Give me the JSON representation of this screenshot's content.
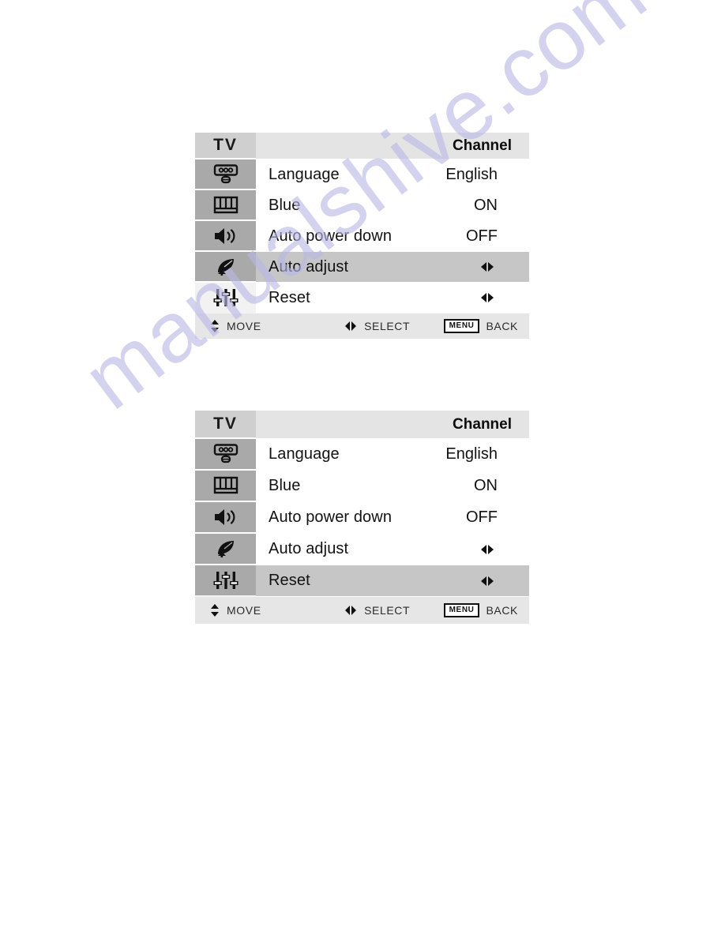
{
  "page": {
    "watermark": "manualshive.com",
    "watermark_color": "#b9b7e6",
    "background": "#ffffff"
  },
  "colors": {
    "icon_column": "#a9a9a9",
    "header_cell": "#cfcfcf",
    "header_bar": "#e4e4e4",
    "row_selected": "#c6c6c6",
    "row_normal": "#ffffff",
    "footer": "#e6e6e6",
    "text": "#121212"
  },
  "panels": [
    {
      "id": "panel-auto-adjust-selected",
      "header": {
        "source_label": "TV",
        "title": "Channel"
      },
      "items": [
        {
          "icon": "setup-remote-icon",
          "label": "Language",
          "value": "English",
          "control": "value",
          "selected": false
        },
        {
          "icon": "picture-screen-icon",
          "label": "Blue",
          "value": "ON",
          "control": "value",
          "selected": false
        },
        {
          "icon": "speaker-sound-icon",
          "label": "Auto power down",
          "value": "OFF",
          "control": "value",
          "selected": false
        },
        {
          "icon": "satellite-dish-icon",
          "label": "Auto adjust",
          "value": "",
          "control": "arrows",
          "selected": true
        },
        {
          "icon": "sliders-setup-icon",
          "label": "Reset",
          "value": "",
          "control": "arrows",
          "selected": false
        }
      ],
      "footer": {
        "move_icon": "up-down-arrows-icon",
        "move_label": "MOVE",
        "select_icon": "left-right-arrows-icon",
        "select_label": "SELECT",
        "menu_key_label": "MENU",
        "back_label": "BACK"
      }
    },
    {
      "id": "panel-reset-selected",
      "header": {
        "source_label": "TV",
        "title": "Channel"
      },
      "items": [
        {
          "icon": "setup-remote-icon",
          "label": "Language",
          "value": "English",
          "control": "value",
          "selected": false
        },
        {
          "icon": "picture-screen-icon",
          "label": "Blue",
          "value": "ON",
          "control": "value",
          "selected": false
        },
        {
          "icon": "speaker-sound-icon",
          "label": "Auto power down",
          "value": "OFF",
          "control": "value",
          "selected": false
        },
        {
          "icon": "satellite-dish-icon",
          "label": "Auto adjust",
          "value": "",
          "control": "arrows",
          "selected": false
        },
        {
          "icon": "sliders-setup-icon",
          "label": "Reset",
          "value": "",
          "control": "arrows",
          "selected": true
        }
      ],
      "footer": {
        "move_icon": "up-down-arrows-icon",
        "move_label": "MOVE",
        "select_icon": "left-right-arrows-icon",
        "select_label": "SELECT",
        "menu_key_label": "MENU",
        "back_label": "BACK"
      }
    }
  ]
}
